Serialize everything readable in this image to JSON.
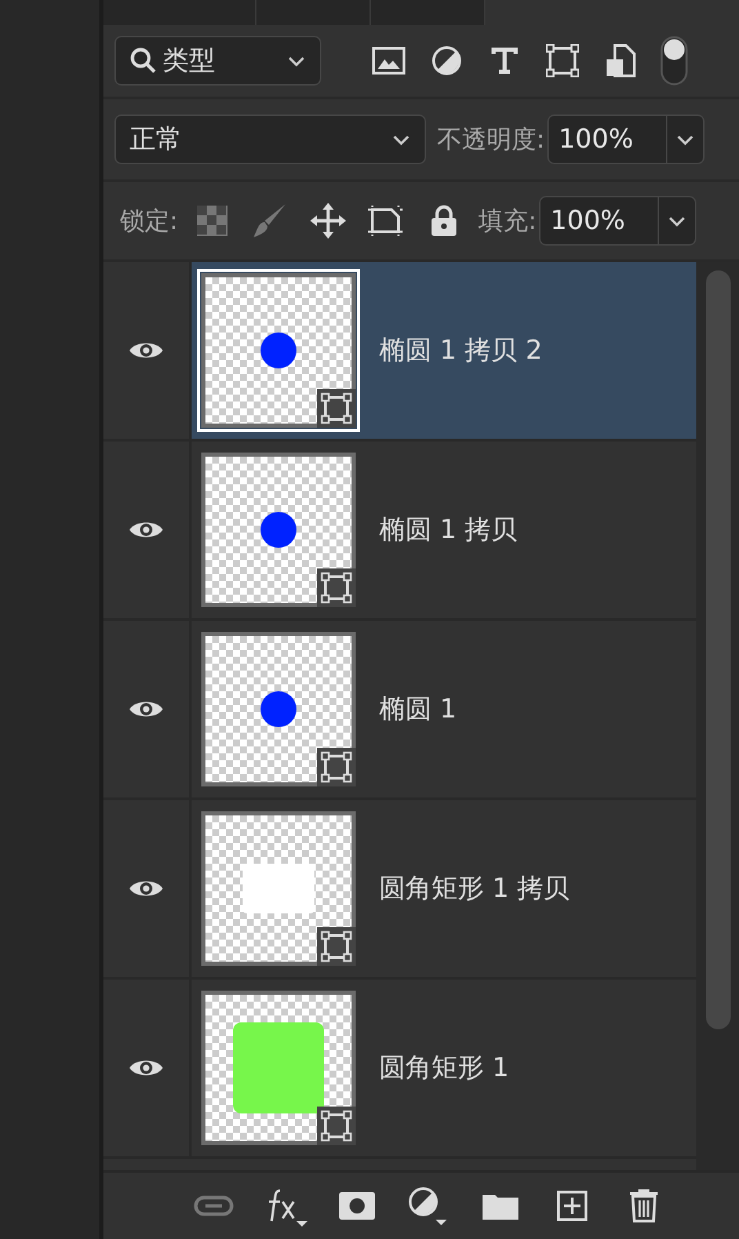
{
  "filter": {
    "label": "类型",
    "on": true
  },
  "blend": {
    "mode": "正常",
    "opacity_label": "不透明度:",
    "opacity": "100%"
  },
  "lock": {
    "label": "锁定:",
    "fill_label": "填充:",
    "fill": "100%"
  },
  "layers": [
    {
      "name": "椭圆 1 拷贝 2",
      "visible": true,
      "selected": true,
      "thumb": {
        "kind": "circle",
        "color": "#0022ff"
      }
    },
    {
      "name": "椭圆 1 拷贝",
      "visible": true,
      "selected": false,
      "thumb": {
        "kind": "circle",
        "color": "#0022ff"
      }
    },
    {
      "name": "椭圆 1",
      "visible": true,
      "selected": false,
      "thumb": {
        "kind": "circle",
        "color": "#0022ff"
      }
    },
    {
      "name": "圆角矩形 1 拷贝",
      "visible": true,
      "selected": false,
      "thumb": {
        "kind": "rect",
        "color": "#ffffff"
      }
    },
    {
      "name": "圆角矩形 1",
      "visible": true,
      "selected": false,
      "thumb": {
        "kind": "bigrect",
        "color": "#77f64b"
      }
    }
  ]
}
